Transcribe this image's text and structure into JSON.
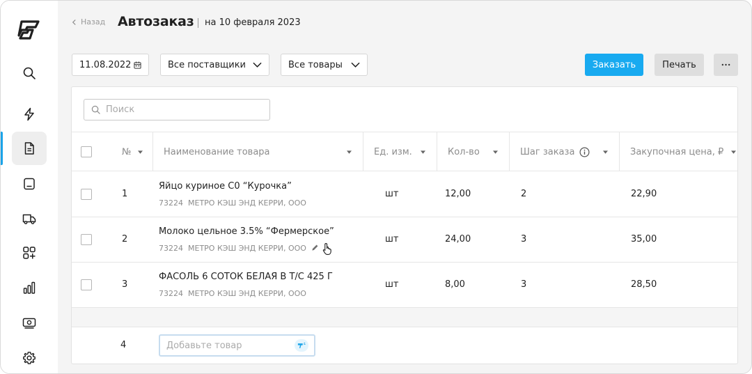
{
  "header": {
    "back_label": "Назад",
    "title": "Автозаказ",
    "subtitle": "на 10 февраля 2023"
  },
  "toolbar": {
    "date_value": "11.08.2022",
    "suppliers_selected": "Все поставщики",
    "goods_selected": "Все товары",
    "order_label": "Заказать",
    "print_label": "Печать"
  },
  "search": {
    "placeholder": "Поиск"
  },
  "table": {
    "columns": [
      "№",
      "Наименование товара",
      "Ед. изм.",
      "Кол-во",
      "Шаг заказа",
      "Закупочная цена, ₽"
    ],
    "rows": [
      {
        "num": "1",
        "name": "Яйцо куриное С0 “Курочка”",
        "code": "73224",
        "supplier": "МЕТРО КЭШ ЭНД КЕРРИ, ООО",
        "unit": "шт",
        "qty": "12,00",
        "step": "2",
        "price": "22,90"
      },
      {
        "num": "2",
        "name": "Молоко цельное 3.5% “Фермерское”",
        "code": "73224",
        "supplier": "МЕТРО КЭШ ЭНД КЕРРИ, ООО",
        "unit": "шт",
        "qty": "24,00",
        "step": "3",
        "price": "35,00"
      },
      {
        "num": "3",
        "name": "ФАСОЛЬ 6 СОТОК БЕЛАЯ В Т/С 425 Г",
        "code": "73224",
        "supplier": "МЕТРО КЭШ ЭНД КЕРРИ, ООО",
        "unit": "шт",
        "qty": "8,00",
        "step": "3",
        "price": "28,50"
      }
    ],
    "add_row": {
      "num": "4",
      "placeholder": "Добавьте товар"
    }
  },
  "colors": {
    "accent": "#18aaf0",
    "active_bar": "#1aa3e8"
  },
  "icons": {
    "sidebar": [
      "search-icon",
      "lightning-icon",
      "document-icon",
      "tablet-icon",
      "truck-icon",
      "grid-plus-icon",
      "bar-chart-icon",
      "cash-icon",
      "gear-icon"
    ],
    "row_actions": [
      "pencil-icon",
      "hand-cursor-icon"
    ]
  }
}
